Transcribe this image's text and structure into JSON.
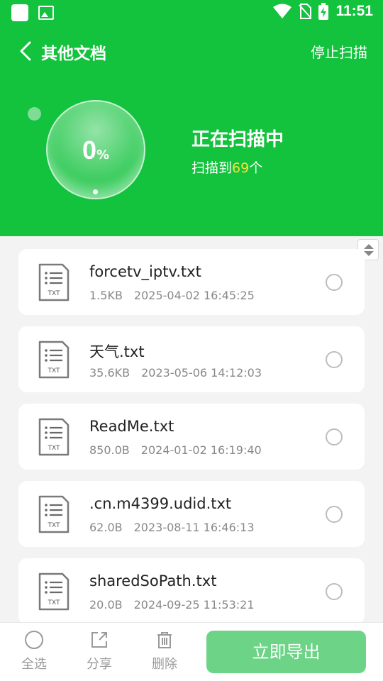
{
  "status_bar": {
    "time": "11:51"
  },
  "app_bar": {
    "title": "其他文档",
    "stop_label": "停止扫描"
  },
  "scan": {
    "percent": "0",
    "percent_sign": "%",
    "status_text": "正在扫描中",
    "count_prefix": "扫描到",
    "count": "69",
    "count_suffix": "个"
  },
  "files": [
    {
      "name": "forcetv_iptv.txt",
      "size": "1.5KB",
      "date": "2025-04-02 16:45:25",
      "icon_label": "TXT"
    },
    {
      "name": "天气.txt",
      "size": "35.6KB",
      "date": "2023-05-06 14:12:03",
      "icon_label": "TXT"
    },
    {
      "name": "ReadMe.txt",
      "size": "850.0B",
      "date": "2024-01-02 16:19:40",
      "icon_label": "TXT"
    },
    {
      "name": ".cn.m4399.udid.txt",
      "size": "62.0B",
      "date": "2023-08-11 16:46:13",
      "icon_label": "TXT"
    },
    {
      "name": "sharedSoPath.txt",
      "size": "20.0B",
      "date": "2024-09-25 11:53:21",
      "icon_label": "TXT"
    }
  ],
  "bottom_bar": {
    "select_all": "全选",
    "share": "分享",
    "delete": "删除",
    "export": "立即导出"
  },
  "colors": {
    "brand_green": "#13c23d",
    "highlight_yellow": "#f7e33a",
    "export_button": "#6dd487"
  }
}
